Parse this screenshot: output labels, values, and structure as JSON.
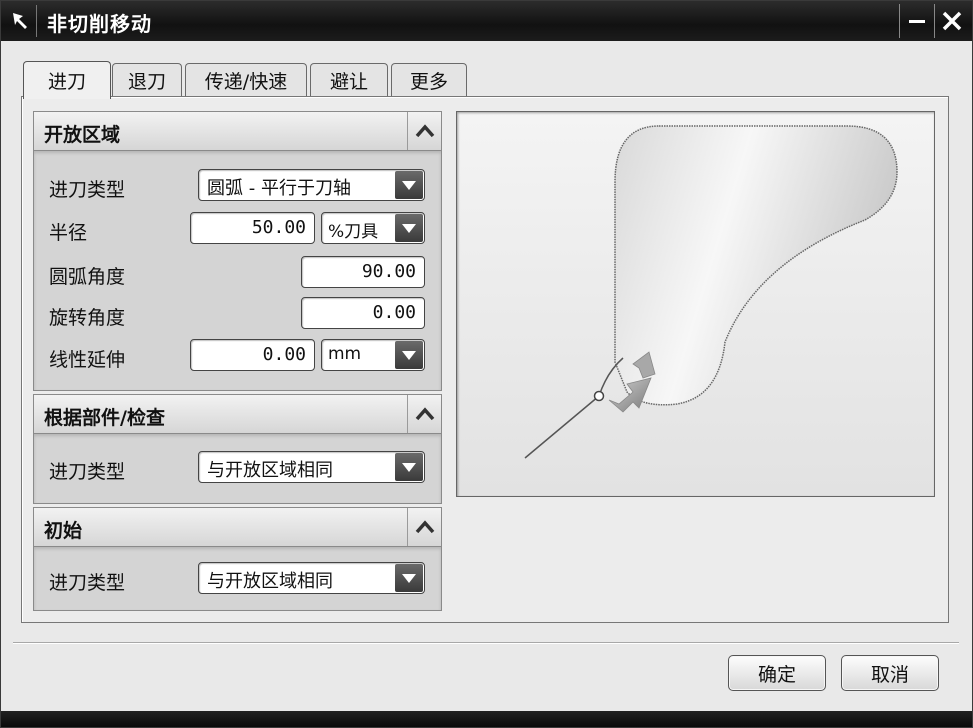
{
  "window": {
    "title": "非切削移动"
  },
  "tabs": [
    {
      "label": "进刀",
      "active": true
    },
    {
      "label": "退刀"
    },
    {
      "label": "传递/快速"
    },
    {
      "label": "避让"
    },
    {
      "label": "更多"
    }
  ],
  "sections": {
    "open_area": {
      "title": "开放区域",
      "engage_type": {
        "label": "进刀类型",
        "value": "圆弧 - 平行于刀轴"
      },
      "radius": {
        "label": "半径",
        "value": "50.00",
        "unit": "%刀具"
      },
      "arc_angle": {
        "label": "圆弧角度",
        "value": "90.00"
      },
      "rotation_angle": {
        "label": "旋转角度",
        "value": "0.00"
      },
      "linear_extension": {
        "label": "线性延伸",
        "value": "0.00",
        "unit": "mm"
      }
    },
    "part_check": {
      "title": "根据部件/检查",
      "engage_type": {
        "label": "进刀类型",
        "value": "与开放区域相同"
      }
    },
    "initial": {
      "title": "初始",
      "engage_type": {
        "label": "进刀类型",
        "value": "与开放区域相同"
      }
    }
  },
  "buttons": {
    "ok": "确定",
    "cancel": "取消"
  },
  "icons": {
    "title": "cursor-arrow-icon",
    "minimize": "minimize-icon",
    "close": "close-icon",
    "collapse": "chevron-up-icon",
    "dropdown": "triangle-down-icon"
  }
}
